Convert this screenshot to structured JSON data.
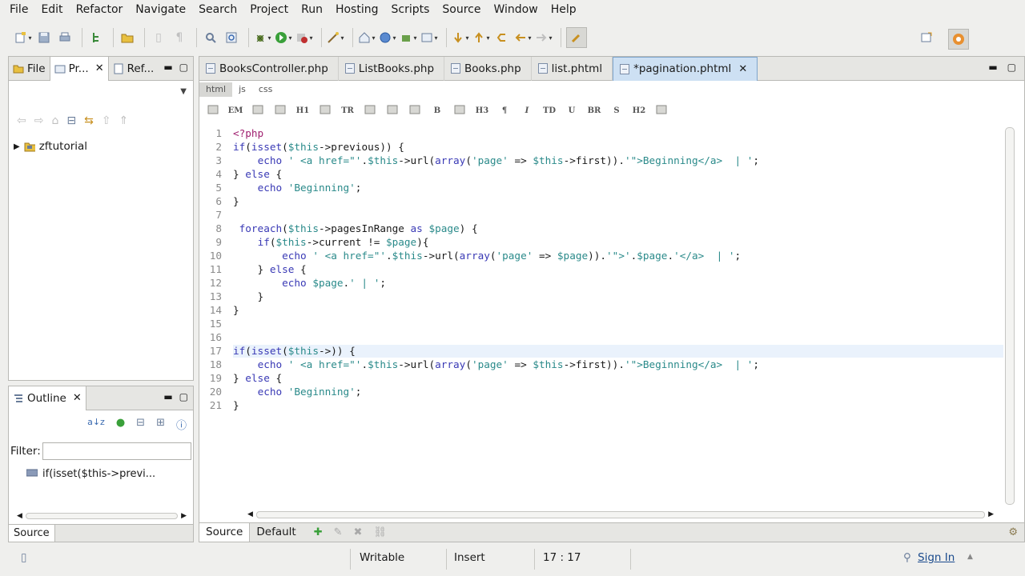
{
  "menu": [
    "File",
    "Edit",
    "Refactor",
    "Navigate",
    "Search",
    "Project",
    "Run",
    "Hosting",
    "Scripts",
    "Source",
    "Window",
    "Help"
  ],
  "left_panel": {
    "tabs": [
      {
        "label": "File",
        "icon": "folder-icon"
      },
      {
        "label": "Pr...",
        "icon": "project-explorer-icon"
      },
      {
        "label": "Ref...",
        "icon": "references-icon"
      }
    ],
    "tree": [
      {
        "label": "zftutorial",
        "icon": "project-folder-icon"
      }
    ]
  },
  "outline": {
    "title": "Outline",
    "filter_label": "Filter:",
    "filter_value": "",
    "items": [
      "if(isset($this->previ..."
    ],
    "bottom_tabs": [
      "Source"
    ]
  },
  "editor": {
    "tabs": [
      {
        "label": "BooksController.php",
        "active": false
      },
      {
        "label": "ListBooks.php",
        "active": false
      },
      {
        "label": "Books.php",
        "active": false
      },
      {
        "label": "list.phtml",
        "active": false
      },
      {
        "label": "*pagination.phtml",
        "active": true
      }
    ],
    "subtabs": [
      "html",
      "js",
      "css"
    ],
    "html_toolbar": [
      "EM",
      "H1",
      "TR",
      "B",
      "H3",
      "¶",
      "I",
      "TD",
      "U",
      "BR",
      "S",
      "H2"
    ],
    "current_line": 17,
    "lines": [
      {
        "n": "1",
        "t": "<?php"
      },
      {
        "n": "2",
        "t": "if(isset($this->previous)) {"
      },
      {
        "n": "3",
        "t": "    echo ' <a href=\"'.$this->url(array('page' => $this->first)).'\">Beginning</a>  | ';"
      },
      {
        "n": "4",
        "t": "} else {"
      },
      {
        "n": "5",
        "t": "    echo 'Beginning';"
      },
      {
        "n": "6",
        "t": "}"
      },
      {
        "n": "7",
        "t": ""
      },
      {
        "n": "8",
        "t": " foreach($this->pagesInRange as $page) {"
      },
      {
        "n": "9",
        "t": "    if($this->current != $page){"
      },
      {
        "n": "10",
        "t": "        echo ' <a href=\"'.$this->url(array('page' => $page)).'\">'.$page.'</a>  | ';"
      },
      {
        "n": "11",
        "t": "    } else {"
      },
      {
        "n": "12",
        "t": "        echo $page.' | ';"
      },
      {
        "n": "13",
        "t": "    }"
      },
      {
        "n": "14",
        "t": "}"
      },
      {
        "n": "15",
        "t": ""
      },
      {
        "n": "16",
        "t": ""
      },
      {
        "n": "17",
        "t": "if(isset($this->)) {"
      },
      {
        "n": "18",
        "t": "    echo ' <a href=\"'.$this->url(array('page' => $this->first)).'\">Beginning</a>  | ';"
      },
      {
        "n": "19",
        "t": "} else {"
      },
      {
        "n": "20",
        "t": "    echo 'Beginning';"
      },
      {
        "n": "21",
        "t": "}"
      }
    ],
    "bottom_tabs": [
      "Source",
      "Default"
    ]
  },
  "status": {
    "writable": "Writable",
    "mode": "Insert",
    "position": "17 : 17",
    "sign_in": "Sign In"
  }
}
